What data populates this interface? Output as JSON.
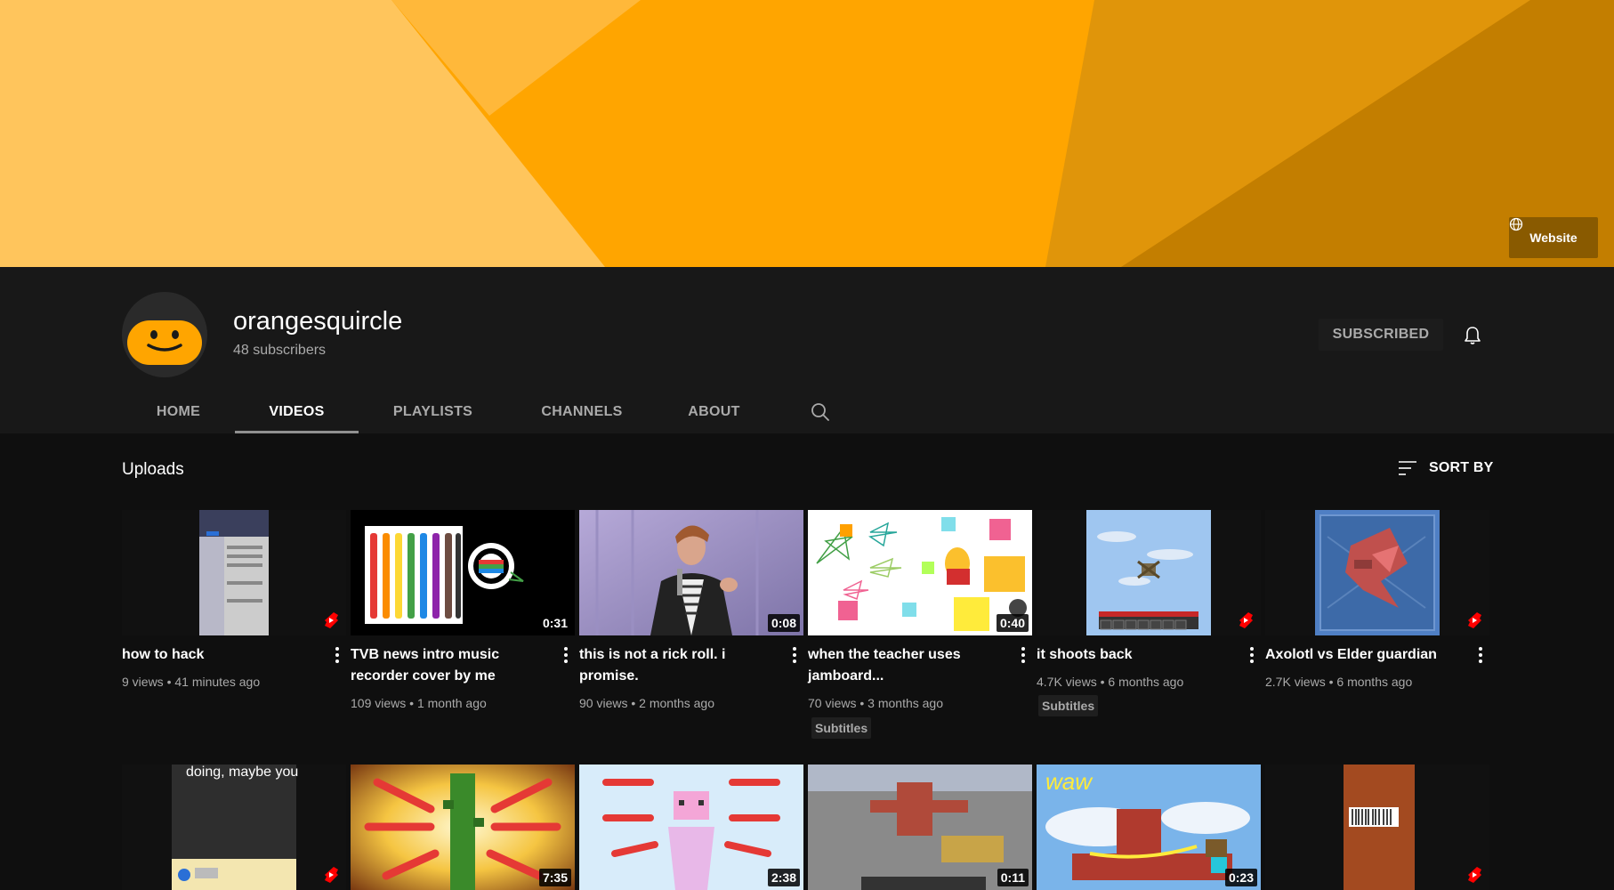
{
  "banner": {
    "website_label": "Website"
  },
  "channel": {
    "name": "orangesquircle",
    "subscribers": "48 subscribers",
    "subscribed_label": "SUBSCRIBED"
  },
  "tabs": [
    "HOME",
    "VIDEOS",
    "PLAYLISTS",
    "CHANNELS",
    "ABOUT"
  ],
  "active_tab": "VIDEOS",
  "section": {
    "title": "Uploads",
    "sort_label": "SORT BY"
  },
  "videos": [
    {
      "title": "how to hack",
      "views": "9 views",
      "age": "41 minutes ago",
      "duration": "",
      "shorts": true,
      "subtitles": ""
    },
    {
      "title": "TVB news intro music recorder cover by me",
      "views": "109 views",
      "age": "1 month ago",
      "duration": "0:31",
      "shorts": false,
      "subtitles": ""
    },
    {
      "title": "this is not a rick roll. i promise.",
      "views": "90 views",
      "age": "2 months ago",
      "duration": "0:08",
      "shorts": false,
      "subtitles": ""
    },
    {
      "title": "when the teacher uses jamboard...",
      "views": "70 views",
      "age": "3 months ago",
      "duration": "0:40",
      "shorts": false,
      "subtitles": "Subtitles"
    },
    {
      "title": "it shoots back",
      "views": "4.7K views",
      "age": "6 months ago",
      "duration": "",
      "shorts": true,
      "subtitles": "Subtitles"
    },
    {
      "title": "Axolotl vs Elder guardian",
      "views": "2.7K views",
      "age": "6 months ago",
      "duration": "",
      "shorts": true,
      "subtitles": ""
    }
  ],
  "videos_row2": [
    {
      "duration": "",
      "shorts": true,
      "overlay_text": "doing, maybe you"
    },
    {
      "duration": "7:35",
      "shorts": false
    },
    {
      "duration": "2:38",
      "shorts": false
    },
    {
      "duration": "0:11",
      "shorts": false
    },
    {
      "duration": "0:23",
      "shorts": false,
      "overlay_text": "waw"
    },
    {
      "duration": "",
      "shorts": true
    }
  ],
  "meta_separator": "•",
  "colors": {
    "banner_light": "#ffc55c",
    "banner_mid": "#ffa500",
    "banner_dark": "#d98a00",
    "shorts_red": "#ff0000"
  }
}
